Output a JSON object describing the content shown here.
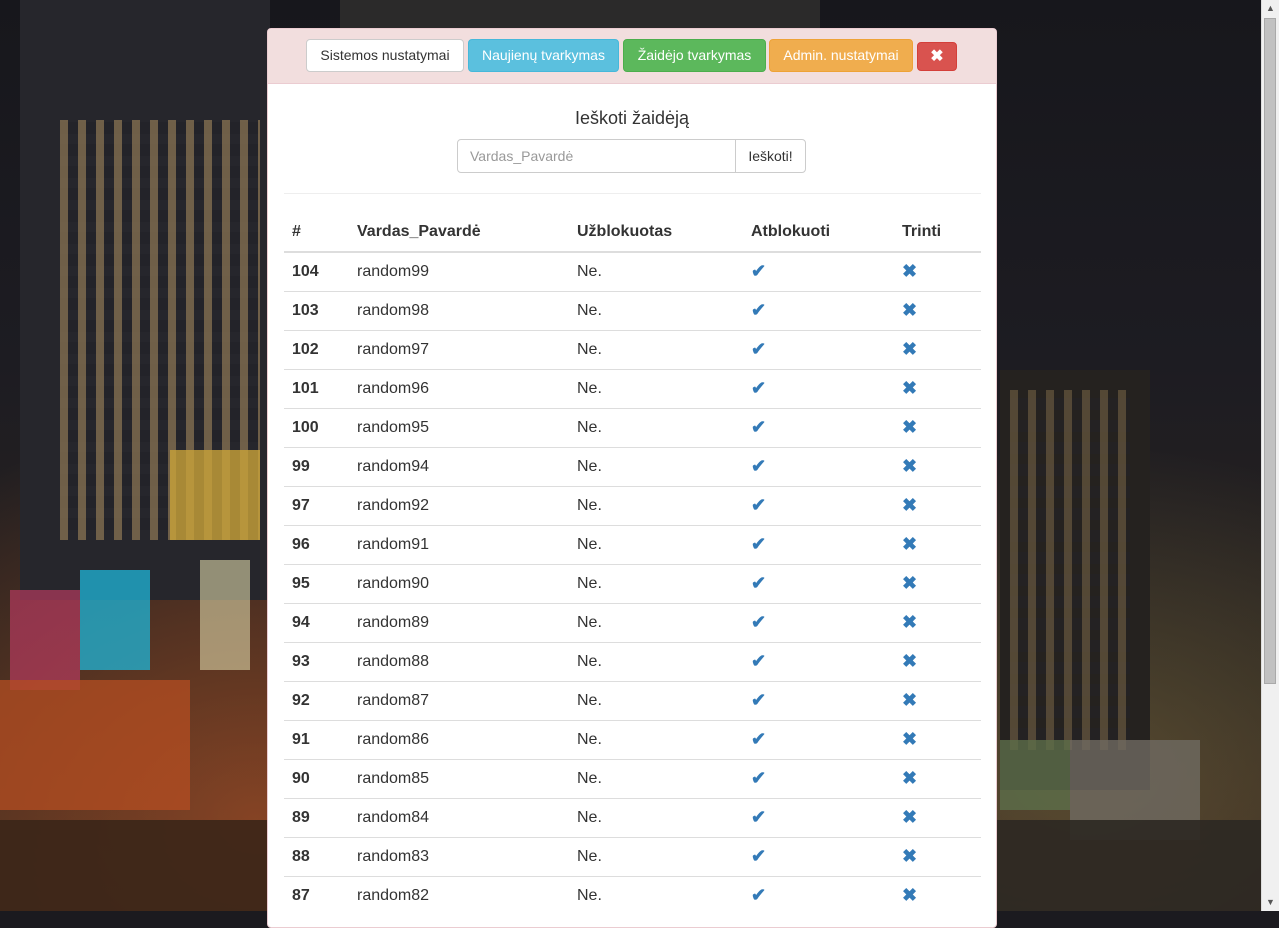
{
  "header": {
    "buttons": [
      {
        "label": "Sistemos nustatymai"
      },
      {
        "label": "Naujienų tvarkymas"
      },
      {
        "label": "Žaidėjo tvarkymas"
      },
      {
        "label": "Admin. nustatymai"
      }
    ],
    "close_icon": "close-icon"
  },
  "search": {
    "title": "Ieškoti žaidėją",
    "placeholder": "Vardas_Pavardė",
    "button_label": "Ieškoti!"
  },
  "table": {
    "headers": [
      "#",
      "Vardas_Pavardė",
      "Užblokuotas",
      "Atblokuoti",
      "Trinti"
    ],
    "unblock_icon": "checkmark-icon",
    "delete_icon": "remove-icon",
    "rows": [
      {
        "id": "104",
        "name": "random99",
        "blocked": "Ne."
      },
      {
        "id": "103",
        "name": "random98",
        "blocked": "Ne."
      },
      {
        "id": "102",
        "name": "random97",
        "blocked": "Ne."
      },
      {
        "id": "101",
        "name": "random96",
        "blocked": "Ne."
      },
      {
        "id": "100",
        "name": "random95",
        "blocked": "Ne."
      },
      {
        "id": "99",
        "name": "random94",
        "blocked": "Ne."
      },
      {
        "id": "97",
        "name": "random92",
        "blocked": "Ne."
      },
      {
        "id": "96",
        "name": "random91",
        "blocked": "Ne."
      },
      {
        "id": "95",
        "name": "random90",
        "blocked": "Ne."
      },
      {
        "id": "94",
        "name": "random89",
        "blocked": "Ne."
      },
      {
        "id": "93",
        "name": "random88",
        "blocked": "Ne."
      },
      {
        "id": "92",
        "name": "random87",
        "blocked": "Ne."
      },
      {
        "id": "91",
        "name": "random86",
        "blocked": "Ne."
      },
      {
        "id": "90",
        "name": "random85",
        "blocked": "Ne."
      },
      {
        "id": "89",
        "name": "random84",
        "blocked": "Ne."
      },
      {
        "id": "88",
        "name": "random83",
        "blocked": "Ne."
      },
      {
        "id": "87",
        "name": "random82",
        "blocked": "Ne."
      }
    ]
  },
  "colors": {
    "panel_header": "#f2dede",
    "info": "#5bc0de",
    "success": "#5cb85c",
    "warning": "#f0ad4e",
    "danger": "#d9534f",
    "icon": "#337ab7"
  }
}
